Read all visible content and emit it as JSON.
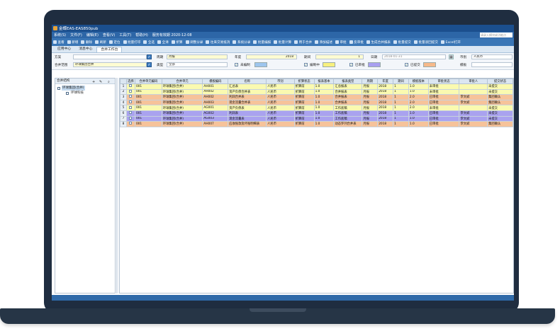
{
  "window": {
    "title": "金蝶EAS-EAS850pub"
  },
  "menu": {
    "items": [
      "系统(S)",
      "文件(F)",
      "编辑(E)",
      "查看(V)",
      "工具(T)",
      "帮助(H)",
      "服务有效期 2020-12-08"
    ],
    "search_placeholder": "请录入模块或功能点"
  },
  "toolbar": {
    "items": [
      "查看",
      "新增",
      "删除",
      "刷新",
      "定位",
      "批量打印",
      "全选",
      "全清",
      "折算",
      "调整分录",
      "往来交易抵消",
      "系统分录",
      "批量编报",
      "批量计算",
      "用于合并",
      "添加描述",
      "审批",
      "反审批",
      "生成合并报表",
      "批量提交",
      "批量驳回提交",
      "Excel打开"
    ]
  },
  "tabs": [
    {
      "label": "应用中心",
      "active": false
    },
    {
      "label": "消息中心",
      "active": false
    },
    {
      "label": "合并工作台",
      "active": true
    }
  ],
  "filter": {
    "scheme_label": "方案",
    "scheme_value": "",
    "period_type_label": "周期",
    "period_type_value": "月报",
    "year_label": "年度",
    "year_value": "2018",
    "period_label": "期间",
    "period_value": "1",
    "date_label": "日期",
    "date_value": "2018-01-31",
    "currency_label": "币别",
    "currency_value": "人民币",
    "scope_label": "合并范围",
    "scope_value": "环球集团合并",
    "type_label": "类型",
    "type_value": "全部",
    "status_draft": "未编制",
    "status_editing": "编制中",
    "status_approved": "已审批",
    "status_submitted": "已提交",
    "template_label": "模板",
    "template_value": "",
    "colors": {
      "draft": "#9ec6ee",
      "editing": "#f8f07e",
      "approved": "#a89ff0",
      "submitted": "#f6b98a"
    }
  },
  "tree": {
    "header": "合并结构",
    "icons": [
      "add-icon",
      "edit-icon",
      "search-icon"
    ],
    "nodes": [
      {
        "label": "环球集团(合并)",
        "level": 0
      },
      {
        "label": "环球科技",
        "level": 1
      }
    ]
  },
  "grid": {
    "columns": [
      "",
      "选择",
      "合并单元编码",
      "合并单元",
      "模板编码",
      "名称",
      "币别",
      "折算状态",
      "报表基本",
      "报表类型",
      "周期",
      "年度",
      "期间",
      "模板版本",
      "审批状态",
      "审批人",
      "提交状态"
    ],
    "rows": [
      {
        "n": "1",
        "unit_code": "001",
        "unit": "环球集团(合并)",
        "code": "AH001",
        "name": "汇总表",
        "currency": "人民币",
        "conv": "折算前",
        "base": "1.0",
        "rtype": "汇总报表",
        "period_type": "月报",
        "year": "2018",
        "period": "1",
        "ver": "1.0",
        "approve": "未审批",
        "approver": "",
        "submit": "未提交",
        "color": "#fafab0"
      },
      {
        "n": "2",
        "unit_code": "001",
        "unit": "环球集团(合并)",
        "code": "AH002",
        "name": "资产负债合并表",
        "currency": "人民币",
        "conv": "折算前",
        "base": "1.0",
        "rtype": "合并报表",
        "period_type": "月报",
        "year": "2018",
        "period": "1",
        "ver": "1.0",
        "approve": "未审批",
        "approver": "",
        "submit": "未提交",
        "color": "#fafab0"
      },
      {
        "n": "3",
        "unit_code": "001",
        "unit": "环球集团(合并)",
        "code": "AH002",
        "name": "利润合并表",
        "currency": "人民币",
        "conv": "折算前",
        "base": "1.0",
        "rtype": "合并报表",
        "period_type": "月报",
        "year": "2018",
        "period": "1",
        "ver": "2.0",
        "approve": "已审批",
        "approver": "李文斌",
        "submit": "集团确认",
        "color": "#f6c39a"
      },
      {
        "n": "4",
        "unit_code": "001",
        "unit": "环球集团(合并)",
        "code": "AH003",
        "name": "现金流量合并表",
        "currency": "人民币",
        "conv": "折算前",
        "base": "1.0",
        "rtype": "合并报表",
        "period_type": "月报",
        "year": "2018",
        "period": "1",
        "ver": "2.0",
        "approve": "已审批",
        "approver": "李文斌",
        "submit": "集团确认",
        "color": "#f6c39a"
      },
      {
        "n": "5",
        "unit_code": "001",
        "unit": "环球集团(合并)",
        "code": "AG001",
        "name": "资产负债表",
        "currency": "人民币",
        "conv": "折算前",
        "base": "1.0",
        "rtype": "工作底稿",
        "period_type": "月报",
        "year": "2018",
        "period": "1",
        "ver": "2.0",
        "approve": "未审批",
        "approver": "",
        "submit": "未提交",
        "color": "#fafab0"
      },
      {
        "n": "6",
        "unit_code": "001",
        "unit": "环球集团(合并)",
        "code": "AG002",
        "name": "利润表",
        "currency": "人民币",
        "conv": "折算前",
        "base": "1.0",
        "rtype": "工作底稿",
        "period_type": "月报",
        "year": "2018",
        "period": "1",
        "ver": "1.0",
        "approve": "已审批",
        "approver": "李文斌",
        "submit": "未提交",
        "color": "#a9a2ef"
      },
      {
        "n": "7",
        "unit_code": "001",
        "unit": "环球集团(合并)",
        "code": "AG003",
        "name": "现金流量表",
        "currency": "人民币",
        "conv": "折算前",
        "base": "1.0",
        "rtype": "工作底稿",
        "period_type": "月报",
        "year": "2018",
        "period": "1",
        "ver": "1.0",
        "approve": "已审批",
        "approver": "李文斌",
        "submit": "未提交",
        "color": "#a9a2ef"
      },
      {
        "n": "8",
        "unit_code": "001",
        "unit": "环球集团(合并)",
        "code": "AH007",
        "name": "应收账款及坏账明细表",
        "currency": "人民币",
        "conv": "折算前",
        "base": "1.0",
        "rtype": "动态罗列合并表",
        "period_type": "月报",
        "year": "2018",
        "period": "1",
        "ver": "1.0",
        "approve": "已审批",
        "approver": "李文斌",
        "submit": "集团确认",
        "color": "#f6c39a"
      }
    ]
  }
}
